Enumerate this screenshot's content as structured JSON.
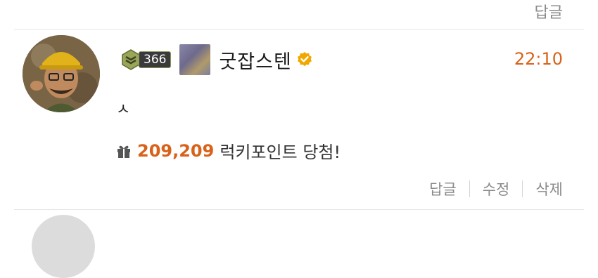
{
  "prev_comment": {
    "reply_label": "답글"
  },
  "comment": {
    "level": "366",
    "username": "굿잡스텐",
    "time": "22:10",
    "text": "ㅅ",
    "lucky_points": "209,209",
    "lucky_text": "럭키포인트 당첨!",
    "actions": {
      "reply": "답글",
      "edit": "수정",
      "delete": "삭제"
    },
    "icons": {
      "avatar": "avatar-image",
      "level": "level-emblem-icon",
      "verified": "verified-check-icon",
      "gift": "gift-icon"
    },
    "colors": {
      "accent": "#d9621a",
      "verified": "#f0a800"
    }
  }
}
